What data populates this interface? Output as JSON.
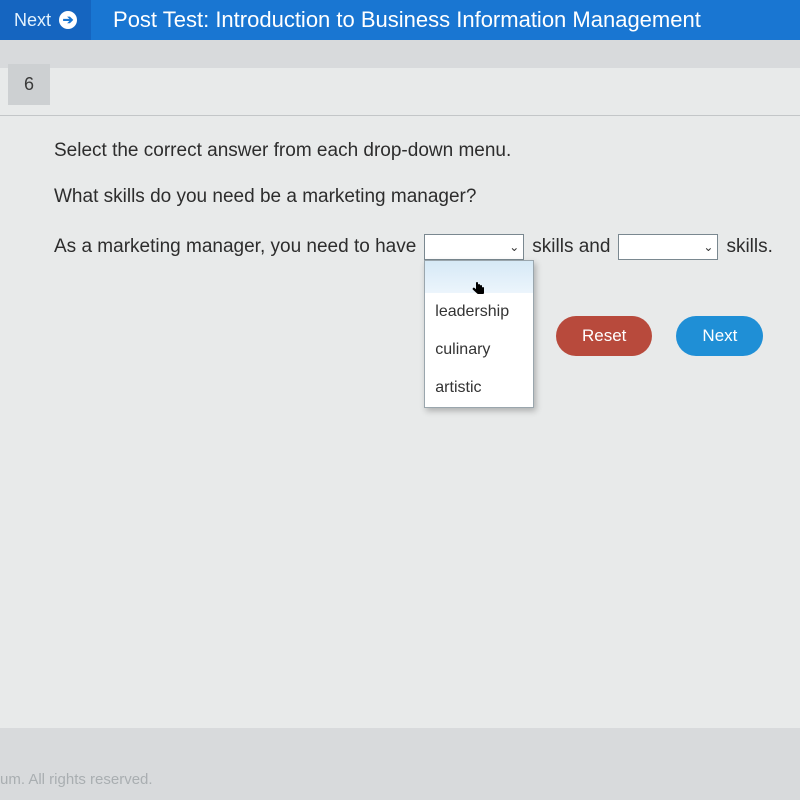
{
  "header": {
    "next_label": "Next",
    "title": "Post Test: Introduction to Business Information Management"
  },
  "question": {
    "number": "6",
    "instruction": "Select the correct answer from each drop-down menu.",
    "prompt": "What skills do you need be a marketing manager?",
    "sentence_part1": "As a marketing manager, you need to have",
    "sentence_part2": "skills and",
    "sentence_part3": "skills."
  },
  "dropdown1": {
    "selected": "",
    "options": [
      "",
      "leadership",
      "culinary",
      "artistic"
    ]
  },
  "dropdown2": {
    "selected": ""
  },
  "buttons": {
    "reset": "Reset",
    "next": "Next"
  },
  "footer": "um. All rights reserved."
}
